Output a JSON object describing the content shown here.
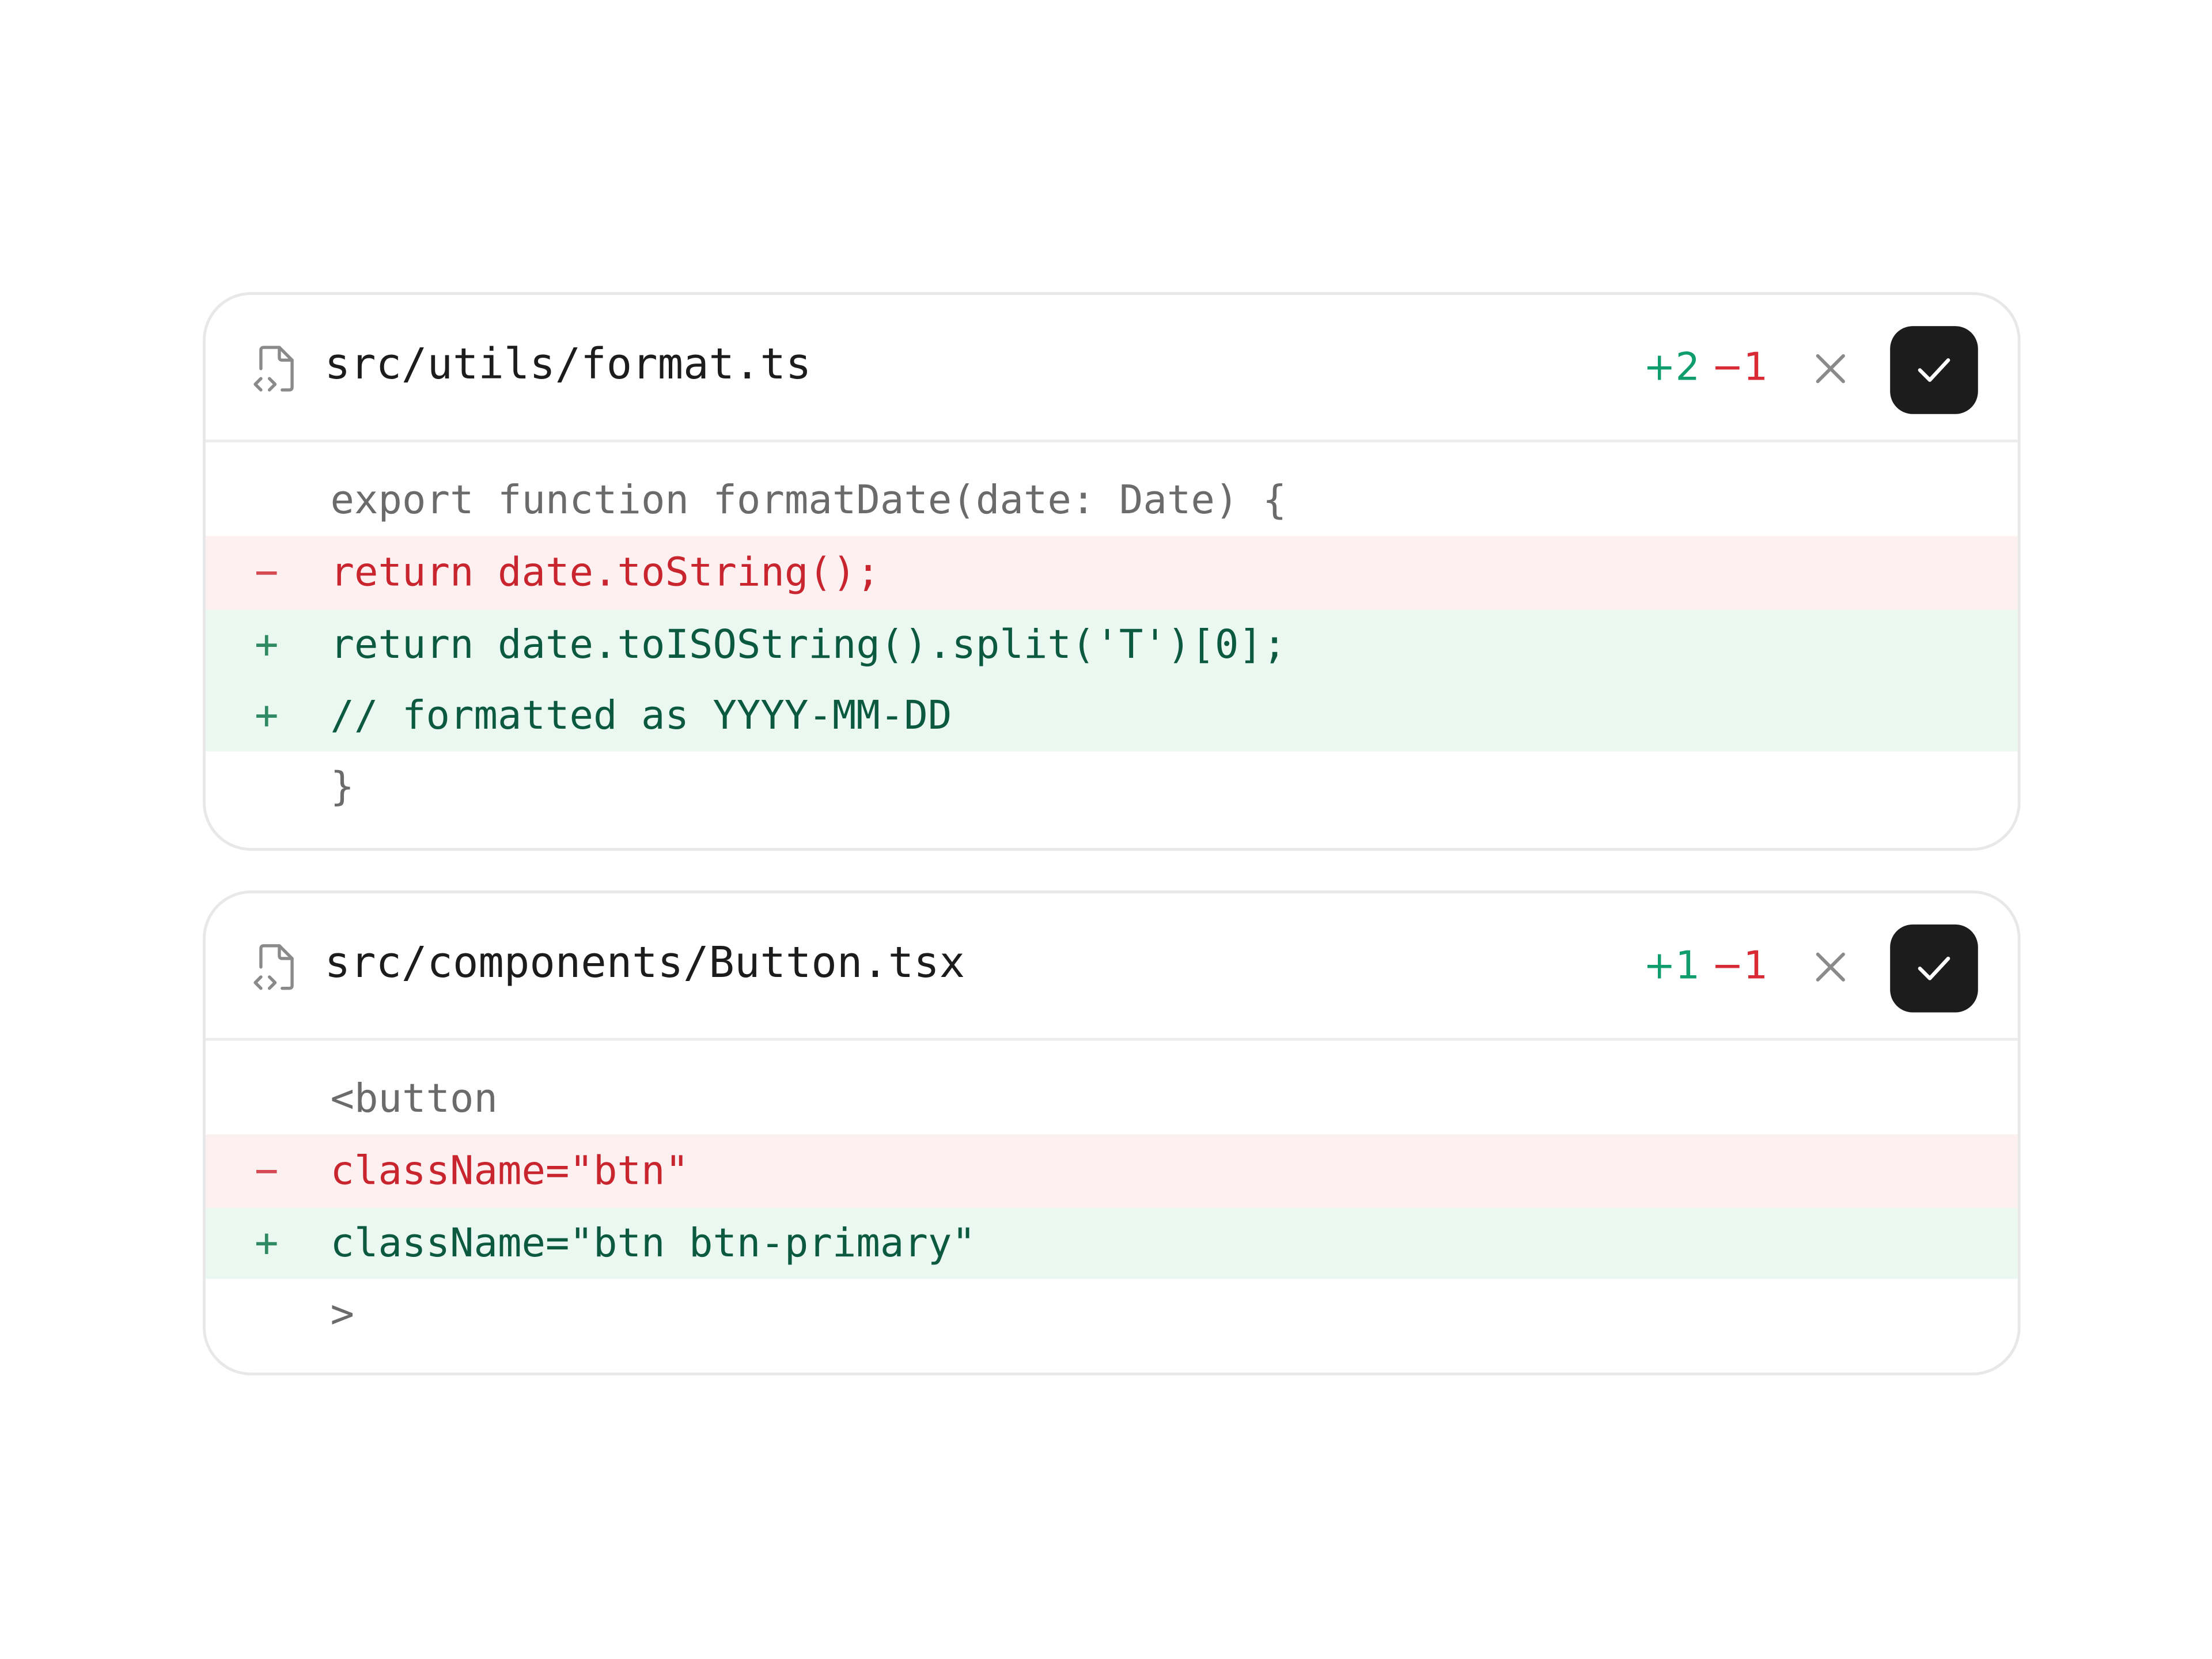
{
  "colors": {
    "addition": "#0f9d6e",
    "deletion": "#d92b36",
    "accept_button": "#1c1c1c",
    "added_line_bg": "#ebf8f2",
    "removed_line_bg": "#fdf0f1"
  },
  "files": [
    {
      "path": "src/utils/format.ts",
      "additions": "+2",
      "deletions": "−1",
      "lines": [
        {
          "type": "context",
          "marker": "",
          "code": "export function formatDate(date: Date) {"
        },
        {
          "type": "removed",
          "marker": "−",
          "code": "return date.toString();"
        },
        {
          "type": "added",
          "marker": "+",
          "code": "return date.toISOString().split('T')[0];"
        },
        {
          "type": "added",
          "marker": "+",
          "code": "// formatted as YYYY-MM-DD"
        },
        {
          "type": "context",
          "marker": "",
          "code": "}"
        }
      ]
    },
    {
      "path": "src/components/Button.tsx",
      "additions": "+1",
      "deletions": "−1",
      "lines": [
        {
          "type": "context",
          "marker": "",
          "code": "<button"
        },
        {
          "type": "removed",
          "marker": "−",
          "code": "className=\"btn\""
        },
        {
          "type": "added",
          "marker": "+",
          "code": "className=\"btn btn-primary\""
        },
        {
          "type": "context",
          "marker": "",
          "code": ">"
        }
      ]
    }
  ],
  "icons": {
    "file": "file-code-icon",
    "reject": "close-icon",
    "accept": "check-icon"
  }
}
